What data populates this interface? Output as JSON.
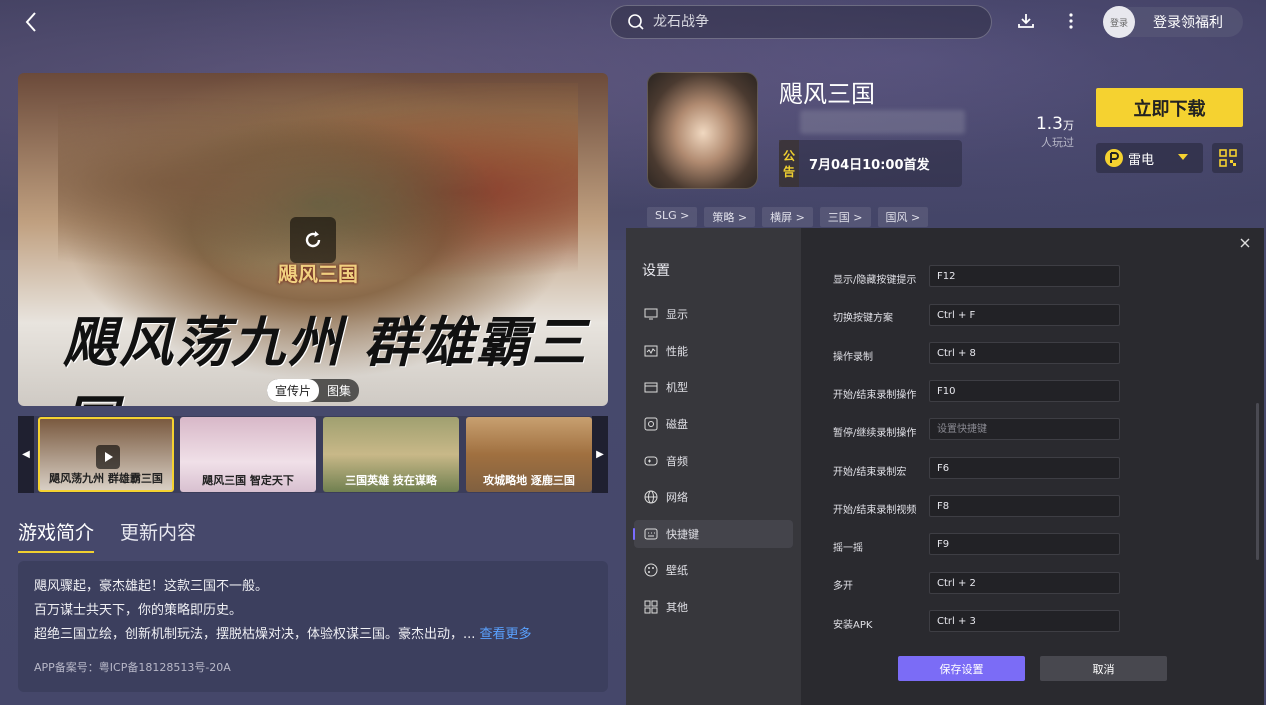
{
  "topbar": {
    "search_placeholder": "龙石战争",
    "login_avatar_text": "登录",
    "login_label": "登录领福利"
  },
  "media": {
    "hero_logo": "飓风三国",
    "hero_slogan": "飓风荡九州 群雄霸三国",
    "tabs": [
      "宣传片",
      "图集"
    ],
    "thumbs": [
      "飓风荡九州 群雄霸三国",
      "飓风三国 智定天下",
      "三国英雄 技在谋略",
      "攻城略地 逐鹿三国"
    ]
  },
  "intro": {
    "tabs": [
      "游戏简介",
      "更新内容"
    ],
    "lines": [
      "飓风骤起，豪杰雄起！这款三国不一般。",
      "百万谋士共天下，你的策略即历史。",
      "超绝三国立绘，创新机制玩法，摆脱枯燥对决，体验权谋三国。豪杰出动，..."
    ],
    "more": "查看更多",
    "icp": "APP备案号：粤ICP备18128513号-20A"
  },
  "game": {
    "title": "飓风三国",
    "notice_tag": [
      "公",
      "告"
    ],
    "notice_text": "7月04日10:00首发",
    "players_num": "1.3",
    "players_unit": "万",
    "players_label": "人玩过",
    "download_label": "立即下载",
    "engine": "雷电",
    "tags": [
      "SLG >",
      "策略 >",
      "横屏 >",
      "三国 >",
      "国风 >"
    ]
  },
  "settings": {
    "title": "设置",
    "menu": [
      {
        "label": "显示",
        "icon": "monitor-icon"
      },
      {
        "label": "性能",
        "icon": "performance-icon"
      },
      {
        "label": "机型",
        "icon": "phone-model-icon"
      },
      {
        "label": "磁盘",
        "icon": "disk-icon"
      },
      {
        "label": "音频",
        "icon": "audio-icon"
      },
      {
        "label": "网络",
        "icon": "globe-icon"
      },
      {
        "label": "快捷键",
        "icon": "keyboard-icon"
      },
      {
        "label": "壁纸",
        "icon": "palette-icon"
      },
      {
        "label": "其他",
        "icon": "grid-icon"
      }
    ],
    "active_menu": "快捷键",
    "shortcuts": [
      {
        "label": "显示/隐藏按键提示",
        "value": "F12",
        "placeholder": ""
      },
      {
        "label": "切换按键方案",
        "value": "Ctrl + F",
        "placeholder": ""
      },
      {
        "label": "操作录制",
        "value": "Ctrl + 8",
        "placeholder": ""
      },
      {
        "label": "开始/结束录制操作",
        "value": "F10",
        "placeholder": ""
      },
      {
        "label": "暂停/继续录制操作",
        "value": "",
        "placeholder": "设置快捷键"
      },
      {
        "label": "开始/结束录制宏",
        "value": "F6",
        "placeholder": ""
      },
      {
        "label": "开始/结束录制视频",
        "value": "F8",
        "placeholder": ""
      },
      {
        "label": "摇一摇",
        "value": "F9",
        "placeholder": ""
      },
      {
        "label": "多开",
        "value": "Ctrl + 2",
        "placeholder": ""
      },
      {
        "label": "安装APK",
        "value": "Ctrl + 3",
        "placeholder": ""
      }
    ],
    "save_label": "保存设置",
    "cancel_label": "取消"
  }
}
